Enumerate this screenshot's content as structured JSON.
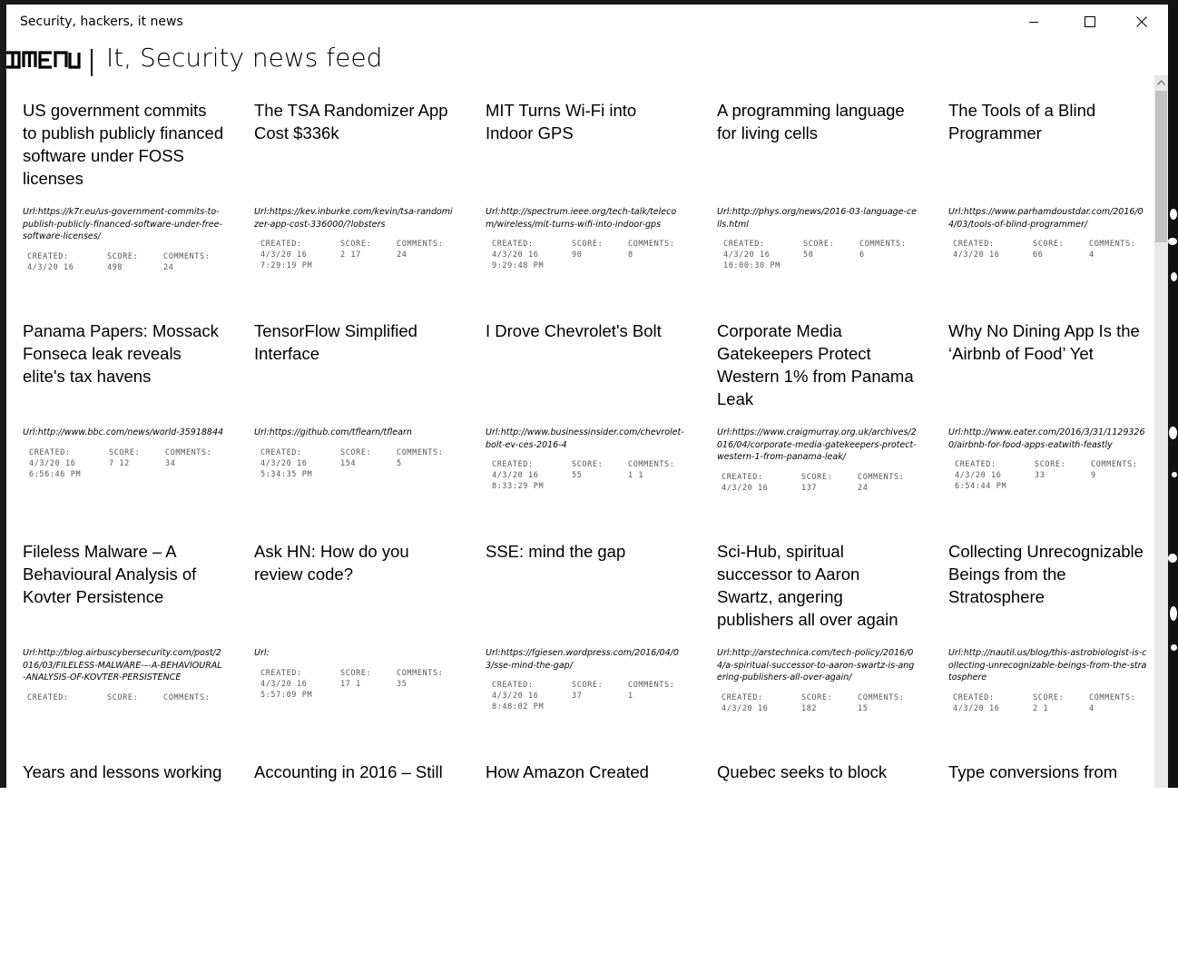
{
  "window": {
    "title": "Security, hackers, it news",
    "controls": [
      "minimize",
      "maximize",
      "close"
    ]
  },
  "header": {
    "menu_label": "MENU",
    "title": "It, Security news feed"
  },
  "labels": {
    "created": "CREATED:",
    "score": "SCORE:",
    "comments": "COMMENTS:"
  },
  "articles": [
    {
      "title": "US government commits to publish publicly financed software under FOSS licenses",
      "url": "Url:https://k7r.eu/us-government-commits-to-publish-publicly-financed-software-under-free-software-licenses/",
      "created": "4/3/20 16",
      "score": "498",
      "comments": "24"
    },
    {
      "title": "The TSA Randomizer App Cost $336k",
      "url": "Url:https://kev.inburke.com/kevin/tsa-randomizer-app-cost-336000/?lobsters",
      "created": "4/3/20 16\n7:29:19 PM",
      "score": "2 17",
      "comments": "24"
    },
    {
      "title": "MIT Turns Wi-Fi into Indoor GPS",
      "url": "Url:http://spectrum.ieee.org/tech-talk/telecom/wireless/mit-turns-wifi-into-indoor-gps",
      "created": "4/3/20 16\n9:29:48 PM",
      "score": "90",
      "comments": "8"
    },
    {
      "title": "A programming language for living cells",
      "url": "Url:http://phys.org/news/2016-03-language-cells.html",
      "created": "4/3/20 16\n10:00:30 PM",
      "score": "50",
      "comments": "6"
    },
    {
      "title": "The Tools of a Blind Programmer",
      "url": "Url:https://www.parhamdoustdar.com/2016/04/03/tools-of-blind-programmer/",
      "created": "4/3/20 16",
      "score": "66",
      "comments": "4"
    },
    {
      "title": "Panama Papers: Mossack Fonseca leak reveals elite's tax havens",
      "url": "Url:http://www.bbc.com/news/world-35918844",
      "created": "4/3/20 16\n6:56:46 PM",
      "score": "7 12",
      "comments": "34"
    },
    {
      "title": "TensorFlow Simplified Interface",
      "url": "Url:https://github.com/tflearn/tflearn",
      "created": "4/3/20 16\n5:34:35 PM",
      "score": "154",
      "comments": "5"
    },
    {
      "title": "I Drove Chevrolet's Bolt",
      "url": "Url:http://www.businessinsider.com/chevrolet-bolt-ev-ces-2016-4",
      "created": "4/3/20 16\n8:33:29 PM",
      "score": "55",
      "comments": "1 1"
    },
    {
      "title": "Corporate Media Gatekeepers Protect Western 1% from Panama Leak",
      "url": "Url:https://www.craigmurray.org.uk/archives/2016/04/corporate-media-gatekeepers-protect-western-1-from-panama-leak/",
      "created": "4/3/20 16",
      "score": "137",
      "comments": "24"
    },
    {
      "title": "Why No Dining App Is the ‘Airbnb of Food’ Yet",
      "url": "Url:http://www.eater.com/2016/3/31/11293260/airbnb-for-food-apps-eatwith-feastly",
      "created": "4/3/20 16\n6:54:44 PM",
      "score": "33",
      "comments": "9"
    },
    {
      "title": "Fileless Malware – A Behavioural Analysis of Kovter Persistence",
      "url": "Url:http://blog.airbuscybersecurity.com/post/2016/03/FILELESS-MALWARE-%E2%80%93-A-BEHAVIOURAL-ANALYSIS-OF-KOVTER-PERSISTENCE",
      "url_display": "Url:http://blog.airbuscybersecurity.com/post/2016/03/FILELESS-MALWARE-–-A-BEHAVIOURAL-ANALYSIS-OF-KOVTER-PERSISTENCE",
      "created": "",
      "score": "",
      "comments": ""
    },
    {
      "title": "Ask HN: How do you review code?",
      "url": "Url:",
      "created": "4/3/20 16\n5:57:09 PM",
      "score": "17 1",
      "comments": "35"
    },
    {
      "title": "SSE: mind the gap",
      "url": "Url:https://fgiesen.wordpress.com/2016/04/03/sse-mind-the-gap/",
      "created": "4/3/20 16\n8:48:02 PM",
      "score": "37",
      "comments": "1"
    },
    {
      "title": "Sci-Hub, spiritual successor to Aaron Swartz, angering publishers all over again",
      "url": "Url:http://arstechnica.com/tech-policy/2016/04/a-spiritual-successor-to-aaron-swartz-is-angering-publishers-all-over-again/",
      "created": "4/3/20 16",
      "score": "182",
      "comments": "15"
    },
    {
      "title": "Collecting Unrecognizable Beings from the Stratosphere",
      "url": "Url:http://nautil.us/blog/this-astrobiologist-is-collecting-unrecognizable-beings-from-the-stratosphere",
      "created": "4/3/20 16",
      "score": "2 1",
      "comments": "4"
    },
    {
      "title": "Years and lessons working",
      "url": "",
      "created": "",
      "score": "",
      "comments": ""
    },
    {
      "title": "Accounting in 2016 – Still",
      "url": "",
      "created": "",
      "score": "",
      "comments": ""
    },
    {
      "title": "How Amazon Created",
      "url": "",
      "created": "",
      "score": "",
      "comments": ""
    },
    {
      "title": "Quebec seeks to block",
      "url": "",
      "created": "",
      "score": "",
      "comments": ""
    },
    {
      "title": "Type conversions from",
      "url": "",
      "created": "",
      "score": "",
      "comments": ""
    }
  ]
}
